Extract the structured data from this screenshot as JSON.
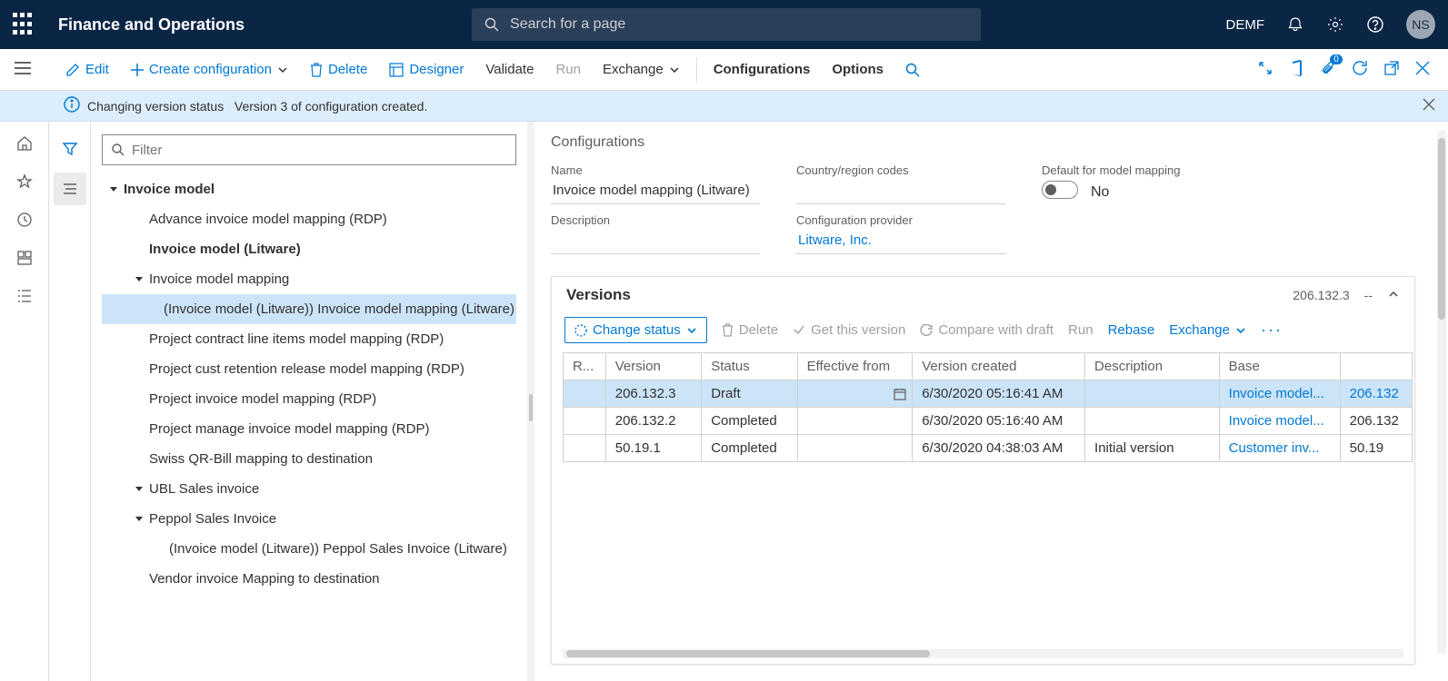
{
  "header": {
    "app_title": "Finance and Operations",
    "search_placeholder": "Search for a page",
    "company": "DEMF",
    "user_initials": "NS"
  },
  "commandbar": {
    "edit": "Edit",
    "create_config": "Create configuration",
    "delete": "Delete",
    "designer": "Designer",
    "validate": "Validate",
    "run": "Run",
    "exchange": "Exchange",
    "configurations": "Configurations",
    "options": "Options",
    "notification_count": "0"
  },
  "infobar": {
    "title": "Changing version status",
    "message": "Version 3 of configuration created."
  },
  "filter_placeholder": "Filter",
  "tree": [
    {
      "level": 0,
      "caret": true,
      "bold": true,
      "label": "Invoice model",
      "selected": false
    },
    {
      "level": 1,
      "caret": false,
      "bold": false,
      "label": "Advance invoice model mapping (RDP)",
      "selected": false
    },
    {
      "level": 1,
      "caret": false,
      "bold": true,
      "label": "Invoice model (Litware)",
      "selected": false
    },
    {
      "level": 1,
      "caret": true,
      "bold": false,
      "label": "Invoice model mapping",
      "selected": false
    },
    {
      "level": 2,
      "caret": false,
      "bold": false,
      "label": "(Invoice model (Litware)) Invoice model mapping (Litware)",
      "selected": true
    },
    {
      "level": 1,
      "caret": false,
      "bold": false,
      "label": "Project contract line items model mapping (RDP)",
      "selected": false
    },
    {
      "level": 1,
      "caret": false,
      "bold": false,
      "label": "Project cust retention release model mapping (RDP)",
      "selected": false
    },
    {
      "level": 1,
      "caret": false,
      "bold": false,
      "label": "Project invoice model mapping (RDP)",
      "selected": false
    },
    {
      "level": 1,
      "caret": false,
      "bold": false,
      "label": "Project manage invoice model mapping (RDP)",
      "selected": false
    },
    {
      "level": 1,
      "caret": false,
      "bold": false,
      "label": "Swiss QR-Bill mapping to destination",
      "selected": false
    },
    {
      "level": 1,
      "caret": true,
      "bold": false,
      "label": "UBL Sales invoice",
      "selected": false
    },
    {
      "level": 2,
      "caret": true,
      "bold": false,
      "label": "Peppol Sales Invoice",
      "selected": false,
      "midcaret": true
    },
    {
      "level": 3,
      "caret": false,
      "bold": false,
      "label": "(Invoice model (Litware)) Peppol Sales Invoice (Litware)",
      "selected": false
    },
    {
      "level": 1,
      "caret": false,
      "bold": false,
      "label": "Vendor invoice Mapping to destination",
      "selected": false
    }
  ],
  "detail": {
    "section_title": "Configurations",
    "name_label": "Name",
    "name_value": "Invoice model mapping (Litware)",
    "country_label": "Country/region codes",
    "country_value": "",
    "default_label": "Default for model mapping",
    "default_value": "No",
    "desc_label": "Description",
    "desc_value": "",
    "provider_label": "Configuration provider",
    "provider_value": "Litware, Inc."
  },
  "versions": {
    "title": "Versions",
    "summary_version": "206.132.3",
    "summary_status": "--",
    "change_status": "Change status",
    "delete": "Delete",
    "get_version": "Get this version",
    "compare": "Compare with draft",
    "run": "Run",
    "rebase": "Rebase",
    "exchange": "Exchange",
    "columns": {
      "r": "R...",
      "version": "Version",
      "status": "Status",
      "effective": "Effective from",
      "created": "Version created",
      "description": "Description",
      "base": "Base",
      "base2": ""
    },
    "rows": [
      {
        "version": "206.132.3",
        "status": "Draft",
        "effective": "",
        "created": "6/30/2020 05:16:41 AM",
        "description": "",
        "base": "Invoice model...",
        "base_v": "206.132",
        "selected": true,
        "datepicker": true
      },
      {
        "version": "206.132.2",
        "status": "Completed",
        "effective": "",
        "created": "6/30/2020 05:16:40 AM",
        "description": "",
        "base": "Invoice model...",
        "base_v": "206.132",
        "selected": false
      },
      {
        "version": "50.19.1",
        "status": "Completed",
        "effective": "",
        "created": "6/30/2020 04:38:03 AM",
        "description": "Initial version",
        "base": "Customer inv...",
        "base_v": "50.19",
        "selected": false
      }
    ]
  }
}
